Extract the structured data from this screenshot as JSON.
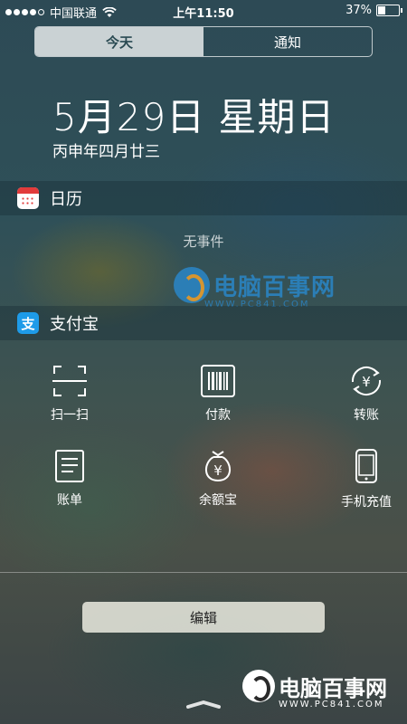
{
  "status_bar": {
    "carrier": "中国联通",
    "time": "上午11:50",
    "battery_percent": "37%",
    "battery_level": 0.37,
    "signal_bars_filled": 4,
    "signal_bars_total": 5
  },
  "segmented_control": {
    "tabs": [
      {
        "label": "今天",
        "selected": true
      },
      {
        "label": "通知",
        "selected": false
      }
    ]
  },
  "date": {
    "main": "5月29日 星期日",
    "lunar": "丙申年四月廿三"
  },
  "calendar_widget": {
    "title": "日历",
    "icon": "calendar-icon",
    "empty_text": "无事件"
  },
  "alipay_widget": {
    "title": "支付宝",
    "icon": "alipay-icon",
    "icon_glyph": "支",
    "shortcuts": [
      {
        "label": "扫一扫",
        "icon": "scan-icon"
      },
      {
        "label": "付款",
        "icon": "barcode-icon"
      },
      {
        "label": "转账",
        "icon": "transfer-icon"
      },
      {
        "label": "账单",
        "icon": "bill-icon"
      },
      {
        "label": "余额宝",
        "icon": "money-bag-icon"
      },
      {
        "label": "手机充值",
        "icon": "phone-icon"
      }
    ]
  },
  "edit_button": {
    "label": "编辑"
  },
  "watermark": {
    "brand": "电脑百事网",
    "url": "WWW.PC841.COM"
  },
  "colors": {
    "alipay_blue": "#1e9be8",
    "calendar_red": "#e23b3b",
    "watermark_blue": "#2a86c8"
  }
}
